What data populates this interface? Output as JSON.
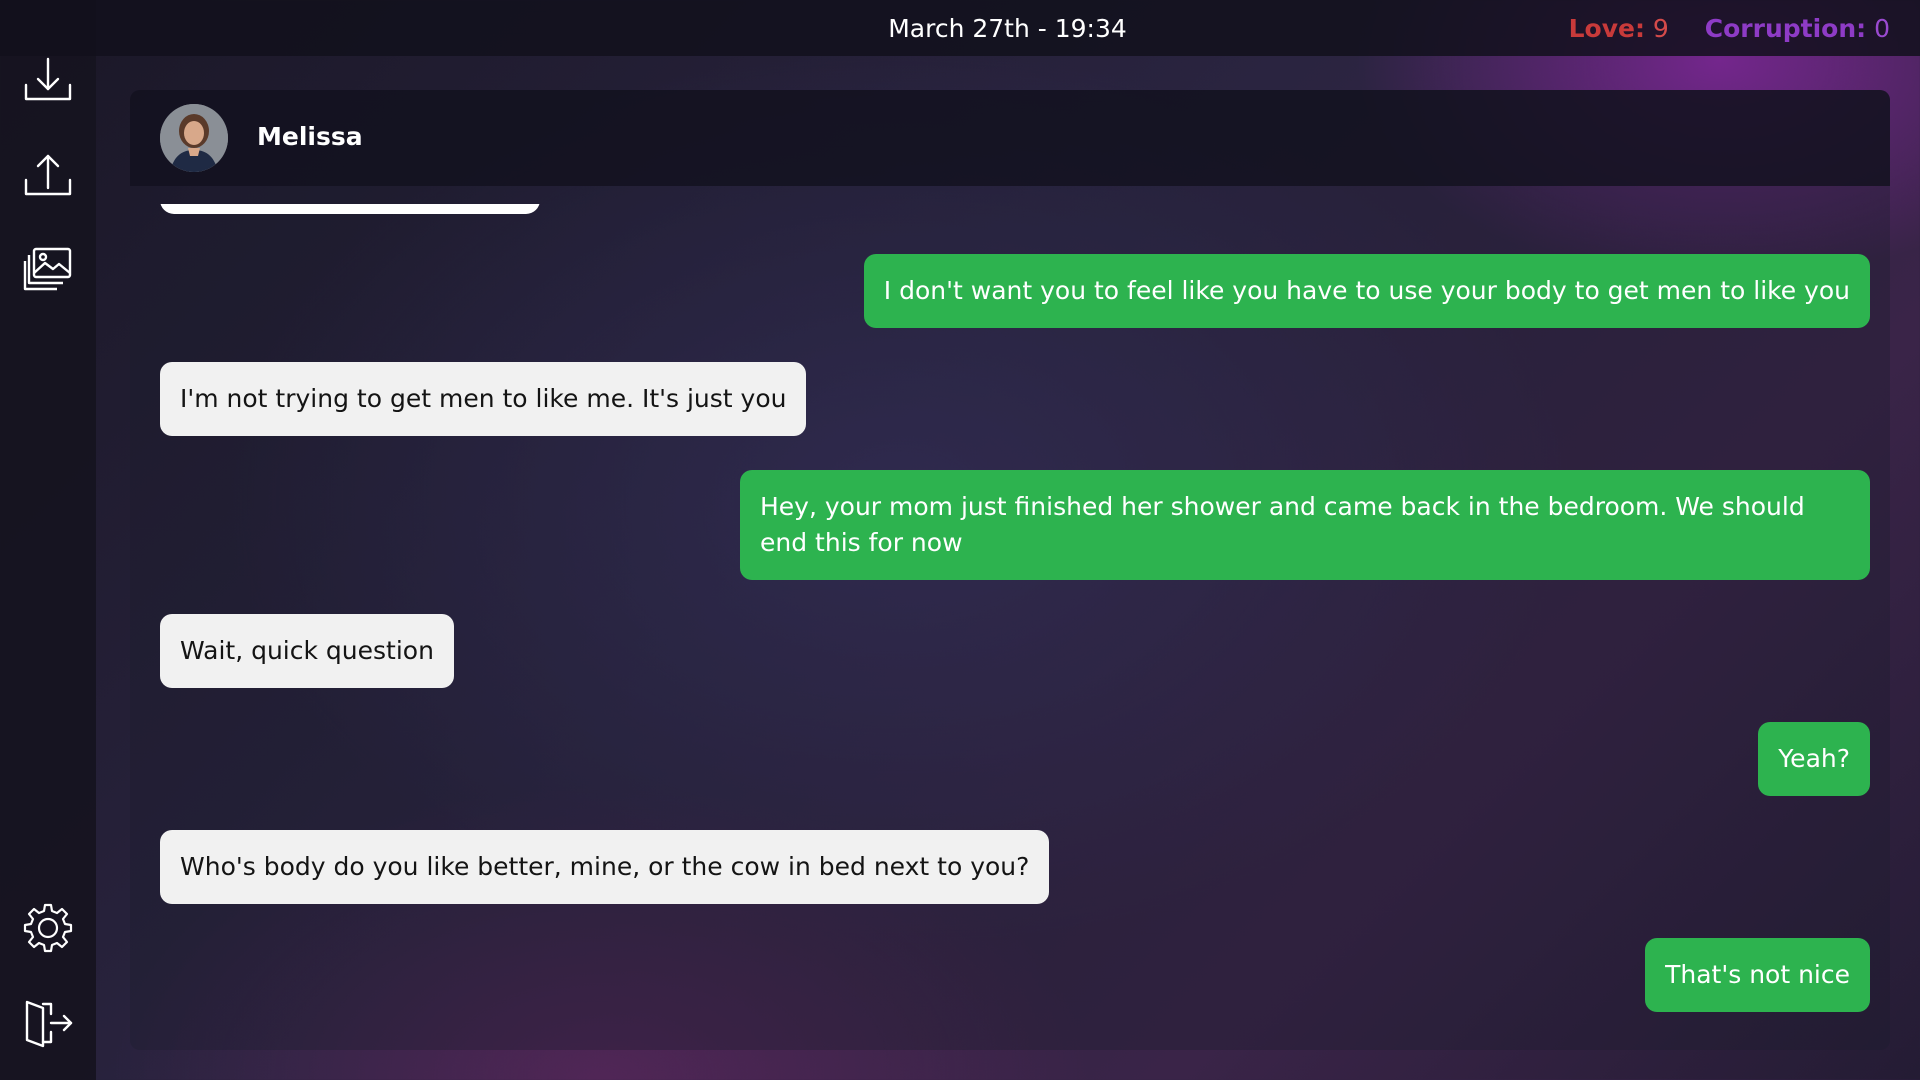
{
  "header": {
    "datetime": "March 27th - 19:34",
    "stats": [
      {
        "label": "Love:",
        "value": "9",
        "color": "#c83a3a"
      },
      {
        "label": "Corruption:",
        "value": "0",
        "color": "#8e3bc6"
      }
    ]
  },
  "sidebar": {
    "top_items": [
      {
        "icon": "download-icon"
      },
      {
        "icon": "upload-icon"
      },
      {
        "icon": "gallery-icon"
      }
    ],
    "bottom_items": [
      {
        "icon": "gear-icon"
      },
      {
        "icon": "exit-icon"
      }
    ]
  },
  "chat": {
    "contact_name": "Melissa",
    "messages": [
      {
        "direction": "out",
        "text": "I don't want you to feel like you have to use your body to get men to like you"
      },
      {
        "direction": "in",
        "text": "I'm not trying to get men to like me. It's just you"
      },
      {
        "direction": "out",
        "text": "Hey, your mom just finished her shower and came back in the bedroom. We should end this for now"
      },
      {
        "direction": "in",
        "text": "Wait, quick question"
      },
      {
        "direction": "out",
        "text": "Yeah?"
      },
      {
        "direction": "in",
        "text": "Who's body do you like better, mine, or the cow in bed next to you?"
      },
      {
        "direction": "out",
        "text": "That's not nice"
      }
    ]
  },
  "colors": {
    "outgoing_bubble": "#2db34f",
    "incoming_bubble": "#f1f1f1"
  }
}
